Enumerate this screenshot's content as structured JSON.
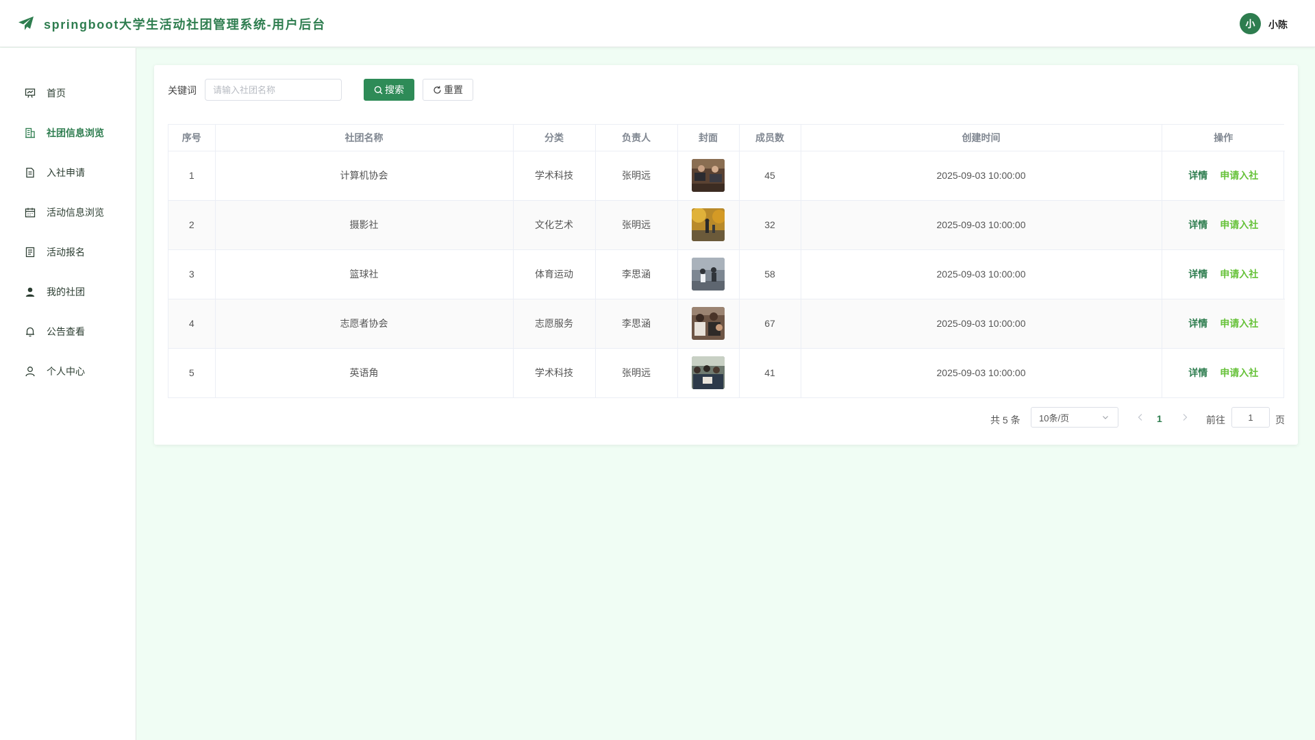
{
  "header": {
    "title": "springboot大学生活动社团管理系统-用户后台",
    "logo_icon": "paper-plane-icon",
    "user_avatar_letter": "小",
    "user_name": "小陈",
    "brand_color": "#2e7d4f"
  },
  "sidebar": {
    "items": [
      {
        "label": "首页",
        "icon": "presentation-board-icon",
        "active": false
      },
      {
        "label": "社团信息浏览",
        "icon": "building-icon",
        "active": true
      },
      {
        "label": "入社申请",
        "icon": "document-icon",
        "active": false
      },
      {
        "label": "活动信息浏览",
        "icon": "calendar-icon",
        "active": false
      },
      {
        "label": "活动报名",
        "icon": "form-icon",
        "active": false
      },
      {
        "label": "我的社团",
        "icon": "user-filled-icon",
        "active": false
      },
      {
        "label": "公告查看",
        "icon": "bell-icon",
        "active": false
      },
      {
        "label": "个人中心",
        "icon": "user-outline-icon",
        "active": false
      }
    ]
  },
  "search": {
    "label": "关键词",
    "placeholder": "请输入社团名称",
    "value": "",
    "search_button": "搜索",
    "reset_button": "重置"
  },
  "table": {
    "columns": [
      "序号",
      "社团名称",
      "分类",
      "负责人",
      "封面",
      "成员数",
      "创建时间",
      "操作"
    ],
    "rows": [
      {
        "index": "1",
        "name": "计算机协会",
        "category": "学术科技",
        "leader": "张明远",
        "members": "45",
        "created": "2025-09-03 10:00:00"
      },
      {
        "index": "2",
        "name": "摄影社",
        "category": "文化艺术",
        "leader": "张明远",
        "members": "32",
        "created": "2025-09-03 10:00:00"
      },
      {
        "index": "3",
        "name": "篮球社",
        "category": "体育运动",
        "leader": "李思涵",
        "members": "58",
        "created": "2025-09-03 10:00:00"
      },
      {
        "index": "4",
        "name": "志愿者协会",
        "category": "志愿服务",
        "leader": "李思涵",
        "members": "67",
        "created": "2025-09-03 10:00:00"
      },
      {
        "index": "5",
        "name": "英语角",
        "category": "学术科技",
        "leader": "张明远",
        "members": "41",
        "created": "2025-09-03 10:00:00"
      }
    ],
    "action_detail": "详情",
    "action_join": "申请入社"
  },
  "pagination": {
    "total_text": "共 5 条",
    "page_size": "10条/页",
    "current_page": "1",
    "goto_label": "前往",
    "goto_value": "1",
    "page_suffix": "页"
  }
}
